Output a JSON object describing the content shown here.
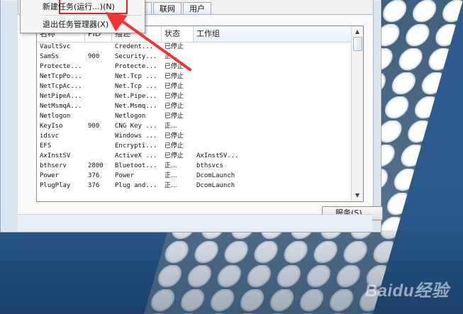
{
  "menu": {
    "new_task": "新建任务(运行...)(N)",
    "exit_task_manager": "退出任务管理器(X)"
  },
  "tabs": [
    "能",
    "联网",
    "用户"
  ],
  "table": {
    "columns": [
      "名称",
      "PID",
      "描述",
      "状态",
      "工作组"
    ],
    "rows": [
      [
        "VaultSvc",
        "",
        "Credent...",
        "已停止",
        ""
      ],
      [
        "SamSs",
        "900",
        "Security...",
        "正...",
        ""
      ],
      [
        "Protecte...",
        "",
        "Protecte...",
        "已停止",
        ""
      ],
      [
        "NetTcpPo...",
        "",
        "Net.Tcp ...",
        "已停止",
        ""
      ],
      [
        "NetTcpAc...",
        "",
        "Net.Tcp ...",
        "已停止",
        ""
      ],
      [
        "NetPipeA...",
        "",
        "Net.Pipe...",
        "已停止",
        ""
      ],
      [
        "NetMsmqA...",
        "",
        "Net.Msmq...",
        "已停止",
        ""
      ],
      [
        "Netlogon",
        "",
        "Netlogon",
        "已停止",
        ""
      ],
      [
        "KeyIso",
        "900",
        "CNG Key ...",
        "正...",
        ""
      ],
      [
        "idsvc",
        "",
        "Windows ...",
        "已停止",
        ""
      ],
      [
        "EFS",
        "",
        "Encrypti...",
        "已停止",
        ""
      ],
      [
        "AxInstSV",
        "",
        "ActiveX ...",
        "已停止",
        "AxInstSV..."
      ],
      [
        "bthserv",
        "2800",
        "Bluetoot...",
        "正...",
        "bthsvcs"
      ],
      [
        "Power",
        "376",
        "Power",
        "正...",
        "DcomLaunch"
      ],
      [
        "PlugPlay",
        "376",
        "Plug and...",
        "正...",
        "DcomLaunch"
      ]
    ]
  },
  "buttons": {
    "services": "服务(S)..."
  },
  "watermark": "Baidu经验",
  "colors": {
    "highlight": "#e62323",
    "arrow": "#ef3434"
  }
}
